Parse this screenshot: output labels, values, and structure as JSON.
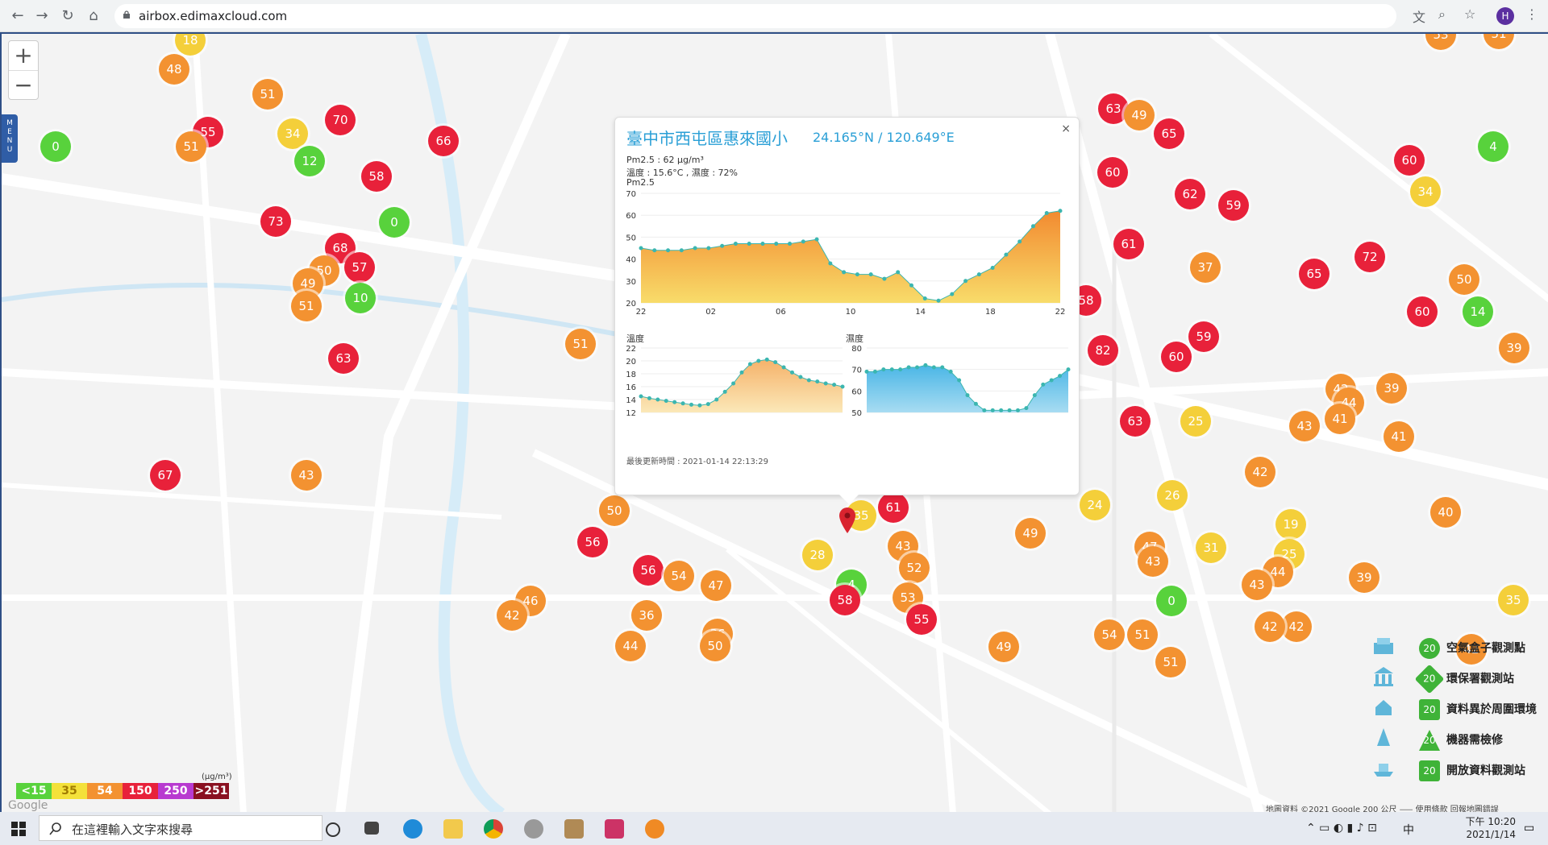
{
  "browser": {
    "url": "airbox.edimaxcloud.com",
    "profile_initial": "H"
  },
  "map": {
    "menu_label": "MENU",
    "zoom_in": "+",
    "zoom_out": "−",
    "google_label": "Google",
    "attribution": "地圖資料 ©2021 Google   200 公尺 ⸺   使用條款   回報地圖錯誤",
    "markers": [
      {
        "v": "18",
        "c": "#f4cf3a"
      },
      {
        "v": "48",
        "c": "#f39231"
      },
      {
        "v": "51",
        "c": "#f39231"
      },
      {
        "v": "55",
        "c": "#e8213a"
      },
      {
        "v": "34",
        "c": "#f4cf3a"
      },
      {
        "v": "70",
        "c": "#e8213a"
      },
      {
        "v": "66",
        "c": "#e8213a"
      },
      {
        "v": "0",
        "c": "#58d23c"
      },
      {
        "v": "51",
        "c": "#f39231"
      },
      {
        "v": "12",
        "c": "#58d23c"
      },
      {
        "v": "58",
        "c": "#e8213a"
      },
      {
        "v": "73",
        "c": "#e8213a"
      },
      {
        "v": "0",
        "c": "#58d23c"
      },
      {
        "v": "68",
        "c": "#e8213a"
      },
      {
        "v": "50",
        "c": "#f39231"
      },
      {
        "v": "57",
        "c": "#e8213a"
      },
      {
        "v": "49",
        "c": "#f39231"
      },
      {
        "v": "10",
        "c": "#58d23c"
      },
      {
        "v": "51",
        "c": "#f39231"
      },
      {
        "v": "63",
        "c": "#e8213a"
      },
      {
        "v": "67",
        "c": "#e8213a"
      },
      {
        "v": "43",
        "c": "#f39231"
      },
      {
        "v": "51",
        "c": "#f39231"
      },
      {
        "v": "58",
        "c": "#e8213a"
      },
      {
        "v": "62",
        "c": "#e8213a"
      },
      {
        "v": "59",
        "c": "#e8213a"
      },
      {
        "v": "50",
        "c": "#f39231"
      },
      {
        "v": "56",
        "c": "#e8213a"
      },
      {
        "v": "56",
        "c": "#e8213a"
      },
      {
        "v": "54",
        "c": "#f39231"
      },
      {
        "v": "47",
        "c": "#f39231"
      },
      {
        "v": "46",
        "c": "#f39231"
      },
      {
        "v": "42",
        "c": "#f39231"
      },
      {
        "v": "36",
        "c": "#f39231"
      },
      {
        "v": "44",
        "c": "#f39231"
      },
      {
        "v": "36",
        "c": "#f39231"
      },
      {
        "v": "50",
        "c": "#f39231"
      },
      {
        "v": "35",
        "c": "#f4cf3a"
      },
      {
        "v": "61",
        "c": "#e8213a"
      },
      {
        "v": "43",
        "c": "#f39231"
      },
      {
        "v": "28",
        "c": "#f4cf3a"
      },
      {
        "v": "52",
        "c": "#f39231"
      },
      {
        "v": "4",
        "c": "#58d23c"
      },
      {
        "v": "58",
        "c": "#e8213a"
      },
      {
        "v": "53",
        "c": "#f39231"
      },
      {
        "v": "55",
        "c": "#e8213a"
      },
      {
        "v": "49",
        "c": "#f39231"
      },
      {
        "v": "49",
        "c": "#f39231"
      },
      {
        "v": "24",
        "c": "#f4cf3a"
      },
      {
        "v": "26",
        "c": "#f4cf3a"
      },
      {
        "v": "47",
        "c": "#f39231"
      },
      {
        "v": "43",
        "c": "#f39231"
      },
      {
        "v": "31",
        "c": "#f4cf3a"
      },
      {
        "v": "0",
        "c": "#58d23c"
      },
      {
        "v": "54",
        "c": "#f39231"
      },
      {
        "v": "51",
        "c": "#f39231"
      },
      {
        "v": "63",
        "c": "#e8213a"
      },
      {
        "v": "49",
        "c": "#f39231"
      },
      {
        "v": "65",
        "c": "#e8213a"
      },
      {
        "v": "60",
        "c": "#e8213a"
      },
      {
        "v": "62",
        "c": "#e8213a"
      },
      {
        "v": "59",
        "c": "#e8213a"
      },
      {
        "v": "61",
        "c": "#e8213a"
      },
      {
        "v": "37",
        "c": "#f39231"
      },
      {
        "v": "58",
        "c": "#e8213a"
      },
      {
        "v": "82",
        "c": "#e8213a"
      },
      {
        "v": "60",
        "c": "#e8213a"
      },
      {
        "v": "59",
        "c": "#e8213a"
      },
      {
        "v": "63",
        "c": "#e8213a"
      },
      {
        "v": "25",
        "c": "#f4cf3a"
      },
      {
        "v": "53",
        "c": "#f39231"
      },
      {
        "v": "51",
        "c": "#f39231"
      },
      {
        "v": "60",
        "c": "#e8213a"
      },
      {
        "v": "4",
        "c": "#58d23c"
      },
      {
        "v": "34",
        "c": "#f4cf3a"
      },
      {
        "v": "72",
        "c": "#e8213a"
      },
      {
        "v": "65",
        "c": "#e8213a"
      },
      {
        "v": "50",
        "c": "#f39231"
      },
      {
        "v": "60",
        "c": "#e8213a"
      },
      {
        "v": "14",
        "c": "#58d23c"
      },
      {
        "v": "39",
        "c": "#f39231"
      },
      {
        "v": "42",
        "c": "#f39231"
      },
      {
        "v": "39",
        "c": "#f39231"
      },
      {
        "v": "44",
        "c": "#f39231"
      },
      {
        "v": "41",
        "c": "#f39231"
      },
      {
        "v": "43",
        "c": "#f39231"
      },
      {
        "v": "41",
        "c": "#f39231"
      },
      {
        "v": "42",
        "c": "#f39231"
      },
      {
        "v": "40",
        "c": "#f39231"
      },
      {
        "v": "19",
        "c": "#f4cf3a"
      },
      {
        "v": "25",
        "c": "#f4cf3a"
      },
      {
        "v": "44",
        "c": "#f39231"
      },
      {
        "v": "43",
        "c": "#f39231"
      },
      {
        "v": "39",
        "c": "#f39231"
      },
      {
        "v": "42",
        "c": "#f39231"
      },
      {
        "v": "35",
        "c": "#f4cf3a"
      },
      {
        "v": "42",
        "c": "#f39231"
      },
      {
        "v": "42",
        "c": "#f39231"
      },
      {
        "v": "51",
        "c": "#f39231"
      }
    ]
  },
  "popup": {
    "title": "臺中市西屯區惠來國小",
    "coords": "24.165°N / 120.649°E",
    "pm25_line": "Pm2.5 : 62 μg/m³",
    "temp_hum_line": "溫度 : 15.6°C , 濕度 : 72%",
    "chart_label": "Pm2.5",
    "temp_label": "溫度",
    "hum_label": "濕度",
    "updated": "最後更新時間 : 2021-01-14 22:13:29",
    "close": "×"
  },
  "chart_data": [
    {
      "type": "area",
      "title": "Pm2.5",
      "x": [
        "22",
        "",
        "",
        "",
        "",
        "02",
        "",
        "",
        "",
        "",
        "06",
        "",
        "",
        "",
        "",
        "10",
        "",
        "",
        "",
        "",
        "14",
        "",
        "",
        "",
        "",
        "18",
        "",
        "",
        "",
        "",
        "22"
      ],
      "xticks": [
        "22",
        "02",
        "06",
        "10",
        "14",
        "18",
        "22"
      ],
      "values": [
        45,
        44,
        44,
        44,
        45,
        45,
        46,
        47,
        47,
        47,
        47,
        47,
        48,
        49,
        38,
        34,
        33,
        33,
        31,
        34,
        28,
        22,
        21,
        24,
        30,
        33,
        36,
        42,
        48,
        55,
        61,
        62
      ],
      "ylim": [
        20,
        70
      ],
      "yticks": [
        20,
        30,
        40,
        50,
        60,
        70
      ]
    },
    {
      "type": "area",
      "title": "溫度",
      "values": [
        14.5,
        14.2,
        14,
        13.8,
        13.6,
        13.4,
        13.2,
        13.1,
        13.3,
        14,
        15.2,
        16.5,
        18.2,
        19.5,
        20,
        20.2,
        19.8,
        19,
        18.2,
        17.5,
        17,
        16.8,
        16.5,
        16.3,
        16
      ],
      "ylim": [
        12,
        22
      ],
      "yticks": [
        12,
        14,
        16,
        18,
        20,
        22
      ]
    },
    {
      "type": "area",
      "title": "濕度",
      "values": [
        69,
        69,
        70,
        70,
        70,
        71,
        71,
        72,
        71,
        71,
        69,
        65,
        58,
        54,
        51,
        51,
        51,
        51,
        51,
        52,
        58,
        63,
        65,
        67,
        70
      ],
      "ylim": [
        50,
        80
      ],
      "yticks": [
        50,
        60,
        70,
        80
      ]
    }
  ],
  "legend": {
    "unit": "(μg/m³)",
    "items": [
      {
        "label": "<15",
        "color": "#58d23c"
      },
      {
        "label": "35",
        "color": "#f4e13a"
      },
      {
        "label": "54",
        "color": "#f39231"
      },
      {
        "label": "150",
        "color": "#e8213a"
      },
      {
        "label": "250",
        "color": "#b83ad0"
      },
      {
        "label": ">251",
        "color": "#8a1020"
      }
    ]
  },
  "station_legend": [
    {
      "badge": "20",
      "label": "空氣盒子觀測點"
    },
    {
      "badge": "20",
      "label": "環保署觀測站"
    },
    {
      "badge": "20",
      "label": "資料異於周圍環境"
    },
    {
      "badge": "20",
      "label": "機器需檢修"
    },
    {
      "badge": "20",
      "label": "開放資料觀測站"
    }
  ],
  "taskbar": {
    "search_placeholder": "在這裡輸入文字來搜尋",
    "time": "下午 10:20",
    "date": "2021/1/14",
    "ime": "中"
  }
}
